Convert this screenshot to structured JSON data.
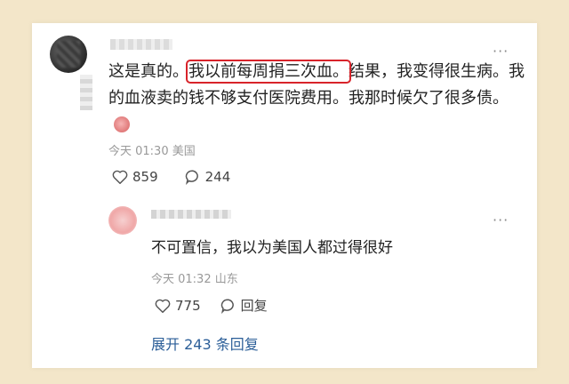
{
  "comment": {
    "text_before": "这是真的。",
    "highlighted_text": "我以前每周捐三次血。",
    "text_after": "结果，我变得很生病。我的血液卖的钱不够支付医院费用。我那时候欠了很多债。",
    "time": "今天 01:30",
    "location": "美国",
    "likes": "859",
    "comments": "244",
    "highlight_color": "#d8232a"
  },
  "reply": {
    "text": "不可置信，我以为美国人都过得很好",
    "time": "今天 01:32",
    "location": "山东",
    "likes": "775",
    "reply_label": "回复"
  },
  "expand_label": "展开 243 条回复",
  "icons": [
    "more-icon",
    "heart-icon",
    "comment-icon",
    "emoji-icon"
  ]
}
